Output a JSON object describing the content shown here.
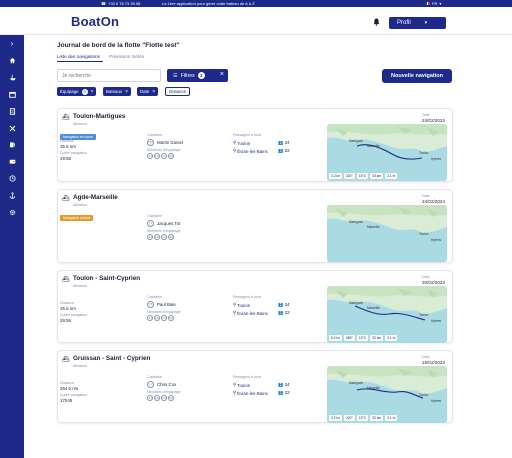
{
  "topbar": {
    "phone": "+33 6 78 73 39 98",
    "tagline": "La 1ère application pour gérer votre bateau de A à Z",
    "lang": "FR",
    "flag_colors": [
      "#1f3f9a",
      "#ffffff",
      "#e0313a"
    ]
  },
  "header": {
    "logo": "BoatOn",
    "profile_label": "Profil"
  },
  "sidebar": {
    "icons": [
      "chevron-right-icon",
      "home-icon",
      "boat-icon",
      "calendar-icon",
      "document-icon",
      "tools-icon",
      "fuel-icon",
      "wallet-icon",
      "clock-icon",
      "anchor-icon",
      "settings-icon"
    ]
  },
  "page": {
    "title": "Journal de bord de la flotte \"Flotte test\"",
    "tabs": [
      "Liste des navigations",
      "Prévisions météo"
    ],
    "search_placeholder": "Je recherche",
    "filters_label": "Filtres",
    "filters_count": "2",
    "new_button": "Nouvelle navigation",
    "chips": [
      {
        "label": "Équipage",
        "count": "3"
      },
      {
        "label": "Bateaux",
        "count": ""
      },
      {
        "label": "Date",
        "count": ""
      },
      {
        "label": "Distance",
        "count": ""
      }
    ]
  },
  "labels": {
    "capitaine": "Capitaine",
    "membres": "Membres d'équipage",
    "passagers": "Passagers à bord",
    "distance": "Distance",
    "duree": "Durée navigation",
    "date": "Date"
  },
  "navigations": [
    {
      "title": "Toulon-Martigues",
      "boat": "Albatros",
      "badge": "Navigation en cours",
      "badge_color": "#4c8ed8",
      "distance": "35.6 nm",
      "duration": "29:55",
      "captain": "Martin Daniel",
      "captain_initials": "MD",
      "crew": [
        "JM",
        "KD",
        "LB",
        "MD"
      ],
      "ports": [
        "Toulon",
        "Évian-les-Bains"
      ],
      "passengers": [
        "24",
        "22"
      ],
      "date": "24/02/2024",
      "stats": [
        "3.2 kn",
        "320°",
        "15°C",
        "33 km",
        "3.1 m"
      ]
    },
    {
      "title": "Agde-Marseille",
      "boat": "Albatros",
      "badge": "Navigation prévue",
      "badge_color": "#e49a2e",
      "distance": "",
      "duration": "",
      "captain": "Jacques Tot",
      "captain_initials": "JT",
      "crew": [
        "JM",
        "KD",
        "LB",
        "MD"
      ],
      "ports": [],
      "passengers": [],
      "date": "24/02/2024",
      "stats": []
    },
    {
      "title": "Toulon - Saint-Cyprien",
      "boat": "Albatros",
      "badge": "",
      "badge_color": "",
      "distance": "25.6 nm",
      "duration": "29:55",
      "captain": "Paul Bale",
      "captain_initials": "PB",
      "crew": [
        "JM",
        "KD",
        "LB",
        "MD"
      ],
      "ports": [
        "Toulon",
        "Évian-les-Bains"
      ],
      "passengers": [
        "24",
        "22"
      ],
      "date": "20/02/2024",
      "stats": [
        "6.2 kn",
        "589°",
        "15°C",
        "33 km",
        "3.1 m"
      ]
    },
    {
      "title": "Gruissan - Saint - Cyprien",
      "boat": "Albatros",
      "badge": "",
      "badge_color": "",
      "distance": "264.5 nm",
      "duration": "17h45",
      "captain": "Chris Cox",
      "captain_initials": "CC",
      "crew": [
        "JM",
        "KD",
        "LB",
        "MD"
      ],
      "ports": [
        "Toulon",
        "Évian-les-Bains"
      ],
      "passengers": [
        "24",
        "22"
      ],
      "date": "15/02/2024",
      "stats": [
        "3.2 kn",
        "320°",
        "15°C",
        "33 km",
        "3.1 m"
      ]
    }
  ],
  "map_places": [
    "Martigues",
    "Marseille",
    "Toulon",
    "Hyères"
  ]
}
